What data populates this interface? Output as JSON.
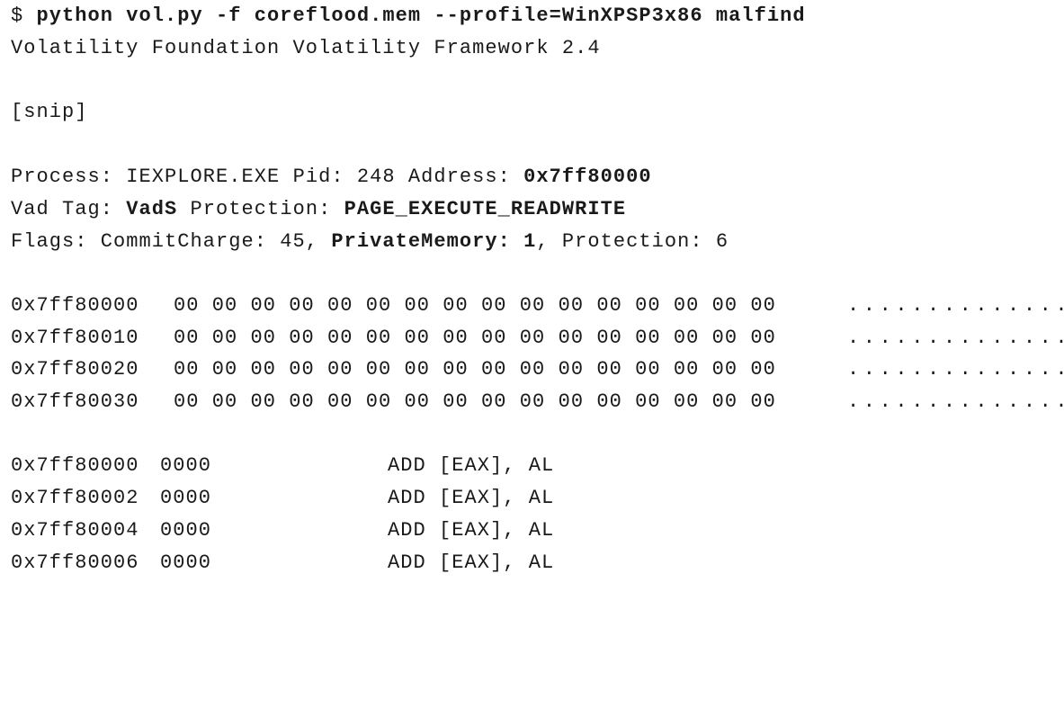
{
  "command": {
    "prompt": "$ ",
    "text": "python vol.py -f coreflood.mem --profile=WinXPSP3x86 malfind"
  },
  "banner": "Volatility Foundation Volatility Framework 2.4",
  "snip": "[snip]",
  "process": {
    "label_process": "Process: ",
    "name": "IEXPLORE.EXE",
    "label_pid": " Pid: ",
    "pid": "248",
    "label_address": " Address: ",
    "address": "0x7ff80000"
  },
  "vad": {
    "label_tag": "Vad Tag: ",
    "tag": "VadS",
    "label_protection": " Protection: ",
    "protection": "PAGE_EXECUTE_READWRITE"
  },
  "flags": {
    "prefix": "Flags: CommitCharge: 45, ",
    "private_memory": "PrivateMemory: 1",
    "suffix": ", Protection: 6"
  },
  "hexdump": [
    {
      "address": "0x7ff80000",
      "bytes": "00 00 00 00 00 00 00 00 00 00 00 00 00 00 00 00",
      "ascii": "................"
    },
    {
      "address": "0x7ff80010",
      "bytes": "00 00 00 00 00 00 00 00 00 00 00 00 00 00 00 00",
      "ascii": "................"
    },
    {
      "address": "0x7ff80020",
      "bytes": "00 00 00 00 00 00 00 00 00 00 00 00 00 00 00 00",
      "ascii": "................"
    },
    {
      "address": "0x7ff80030",
      "bytes": "00 00 00 00 00 00 00 00 00 00 00 00 00 00 00 00",
      "ascii": "................"
    }
  ],
  "disassembly": [
    {
      "address": "0x7ff80000",
      "opcode": "0000",
      "instruction": "ADD [EAX], AL"
    },
    {
      "address": "0x7ff80002",
      "opcode": "0000",
      "instruction": "ADD [EAX], AL"
    },
    {
      "address": "0x7ff80004",
      "opcode": "0000",
      "instruction": "ADD [EAX], AL"
    },
    {
      "address": "0x7ff80006",
      "opcode": "0000",
      "instruction": "ADD [EAX], AL"
    }
  ]
}
